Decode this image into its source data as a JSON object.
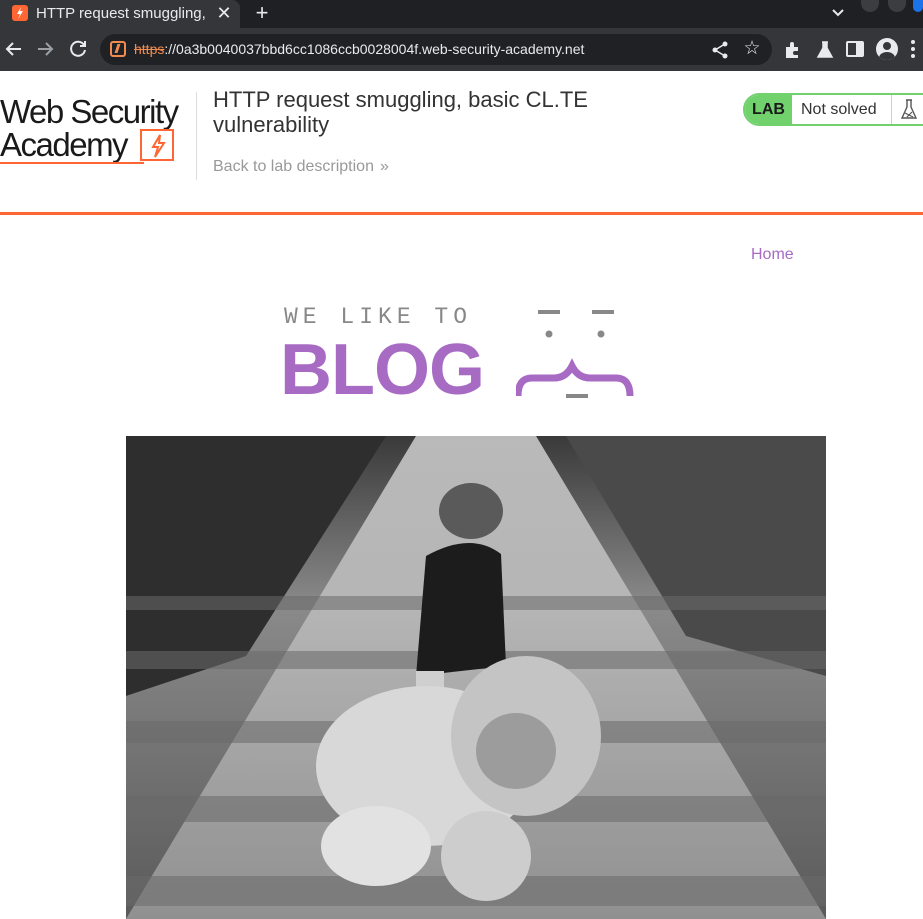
{
  "browser": {
    "tab": {
      "title": "HTTP request smuggling, basic CL.TE vulnerability"
    },
    "omnibox": {
      "scheme": "https",
      "url_rest": "://0a3b0040037bbd6cc1086ccb0028004f.web-security-academy.net"
    },
    "icons": [
      "back-icon",
      "forward-icon",
      "reload-icon",
      "share-icon",
      "star-icon",
      "extensions-icon",
      "flask-icon",
      "side-panel-icon",
      "profile-icon",
      "menu-icon"
    ]
  },
  "academy_header": {
    "logo_line1": "Web Security",
    "logo_line2": "Academy",
    "lab_title": "HTTP request smuggling, basic CL.TE vulnerability",
    "back_link": "Back to lab description",
    "lab_badge": "LAB",
    "lab_state": "Not solved",
    "colors": {
      "accent": "#ff6633",
      "status_green": "#70d16d"
    }
  },
  "blog": {
    "nav": {
      "home": "Home"
    },
    "banner": {
      "small_text": "WE LIKE TO",
      "big_text": "BLOG"
    },
    "hero_image_subject": "girl-with-teddy-bear-on-path",
    "colors": {
      "brand_purple": "#a86bc4"
    }
  }
}
